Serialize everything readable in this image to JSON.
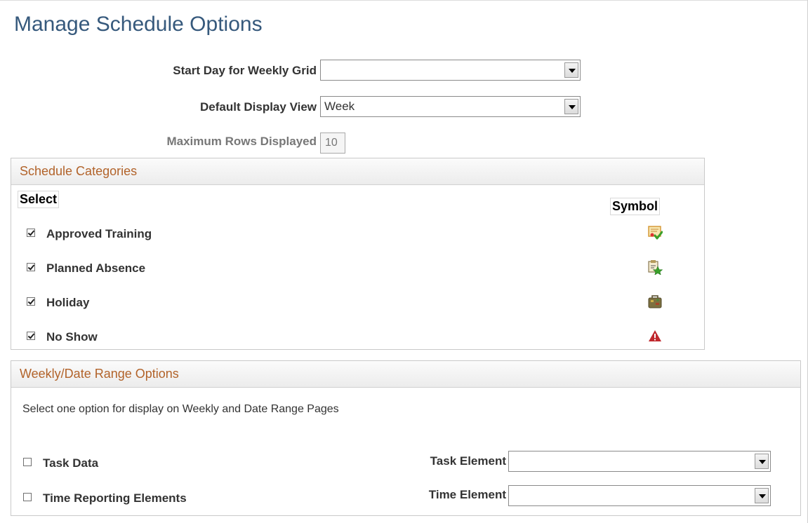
{
  "page": {
    "title": "Manage Schedule Options"
  },
  "fields": {
    "start_day": {
      "label": "Start Day for Weekly Grid",
      "value": ""
    },
    "default_view": {
      "label": "Default Display View",
      "value": "Week"
    },
    "max_rows": {
      "label": "Maximum Rows Displayed",
      "value": "10"
    }
  },
  "schedule_categories": {
    "title": "Schedule Categories",
    "select_header": "Select",
    "symbol_header": "Symbol",
    "items": [
      {
        "label": "Approved Training",
        "checked": true,
        "icon": "training-certificate-icon"
      },
      {
        "label": "Planned Absence",
        "checked": true,
        "icon": "absence-clipboard-star-icon"
      },
      {
        "label": "Holiday",
        "checked": true,
        "icon": "suitcase-icon"
      },
      {
        "label": "No Show",
        "checked": true,
        "icon": "warning-triangle-icon"
      }
    ]
  },
  "weekly_options": {
    "title": "Weekly/Date Range Options",
    "instruction": "Select one option for display on Weekly and Date Range Pages",
    "task_data": {
      "label": "Task Data",
      "checked": false
    },
    "time_reporting": {
      "label": "Time Reporting Elements",
      "checked": false
    },
    "task_element": {
      "label": "Task Element",
      "value": ""
    },
    "time_element": {
      "label": "Time Element",
      "value": ""
    }
  },
  "colors": {
    "title": "#36597c",
    "section_header": "#b2632a",
    "no_show_icon": "#c0282d",
    "check_icon": "#3aa02b"
  }
}
